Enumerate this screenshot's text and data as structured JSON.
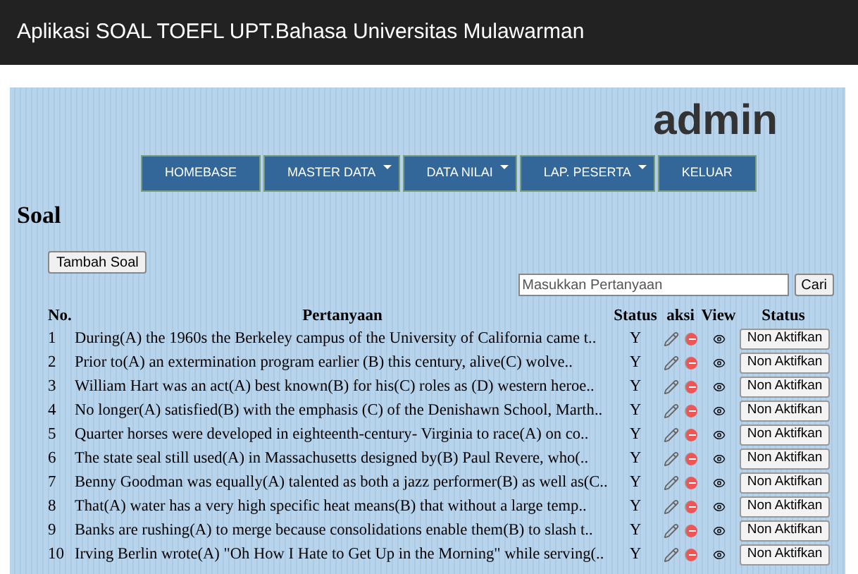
{
  "header": {
    "title": "Aplikasi SOAL TOEFL UPT.Bahasa Universitas Mulawarman"
  },
  "user": "admin",
  "nav": [
    {
      "label": "HOMEBASE",
      "dropdown": false
    },
    {
      "label": "MASTER DATA",
      "dropdown": true
    },
    {
      "label": "DATA NILAI",
      "dropdown": true
    },
    {
      "label": "LAP. PESERTA",
      "dropdown": true
    },
    {
      "label": "KELUAR",
      "dropdown": false
    }
  ],
  "page_title": "Soal",
  "add_button": "Tambah Soal",
  "search": {
    "placeholder": "Masukkan Pertanyaan",
    "button": "Cari"
  },
  "table": {
    "columns": [
      "No.",
      "Pertanyaan",
      "Status",
      "aksi",
      "View",
      "Status"
    ],
    "rows": [
      {
        "no": "1",
        "question": "During(A) the 1960s the Berkeley campus of the University of California came t..",
        "status": "Y",
        "action": "Non Aktifkan"
      },
      {
        "no": "2",
        "question": "Prior to(A) an extermination program earlier (B) this century, alive(C) wolve..",
        "status": "Y",
        "action": "Non Aktifkan"
      },
      {
        "no": "3",
        "question": "William Hart was an act(A) best known(B) for his(C) roles as (D) western heroe..",
        "status": "Y",
        "action": "Non Aktifkan"
      },
      {
        "no": "4",
        "question": "No longer(A) satisfied(B) with the emphasis (C) of the Denishawn School, Marth..",
        "status": "Y",
        "action": "Non Aktifkan"
      },
      {
        "no": "5",
        "question": "Quarter horses were developed in eighteenth-century- Virginia to race(A) on co..",
        "status": "Y",
        "action": "Non Aktifkan"
      },
      {
        "no": "6",
        "question": "The state seal still used(A) in Massachusetts designed by(B) Paul Revere, who(..",
        "status": "Y",
        "action": "Non Aktifkan"
      },
      {
        "no": "7",
        "question": "Benny Goodman was equally(A) talented as both a jazz performer(B) as well as(C..",
        "status": "Y",
        "action": "Non Aktifkan"
      },
      {
        "no": "8",
        "question": "That(A) water has a very high specific heat means(B) that without a large temp..",
        "status": "Y",
        "action": "Non Aktifkan"
      },
      {
        "no": "9",
        "question": "Banks are rushing(A) to merge because consolidations enable them(B) to slash t..",
        "status": "Y",
        "action": "Non Aktifkan"
      },
      {
        "no": "10",
        "question": "Irving Berlin wrote(A) \"Oh How I Hate to Get Up in the Morning\" while serving(..",
        "status": "Y",
        "action": "Non Aktifkan"
      }
    ]
  }
}
